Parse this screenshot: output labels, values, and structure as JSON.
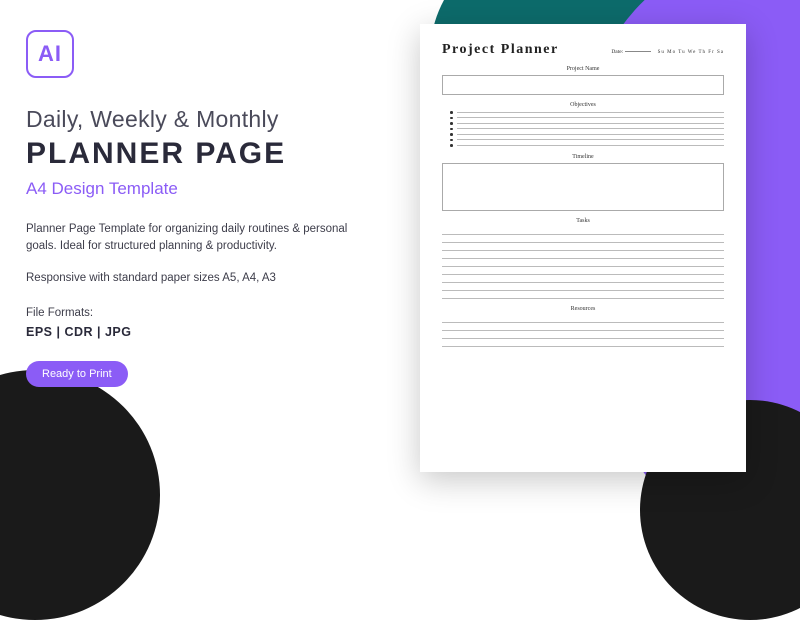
{
  "logo_text": "AI",
  "headline_light": "Daily, Weekly & Monthly",
  "headline_bold": "PLANNER PAGE",
  "subhead": "A4 Design Template",
  "paragraph1": "Planner Page Template for organizing daily routines & personal goals. Ideal for structured planning & productivity.",
  "paragraph2": "Responsive with standard paper sizes A5, A4, A3",
  "formats_label": "File Formats:",
  "formats_list": "EPS  |  CDR  |  JPG",
  "badge_text": "Ready to Print",
  "preview": {
    "title": "Project Planner",
    "date_label": "Date:",
    "days": "Su  Mo  Tu  We  Th  Fr  Sa",
    "sections": {
      "project_name": "Project Name",
      "objectives": "Objectives",
      "timeline": "Timeline",
      "tasks": "Tasks",
      "resources": "Resources"
    }
  }
}
